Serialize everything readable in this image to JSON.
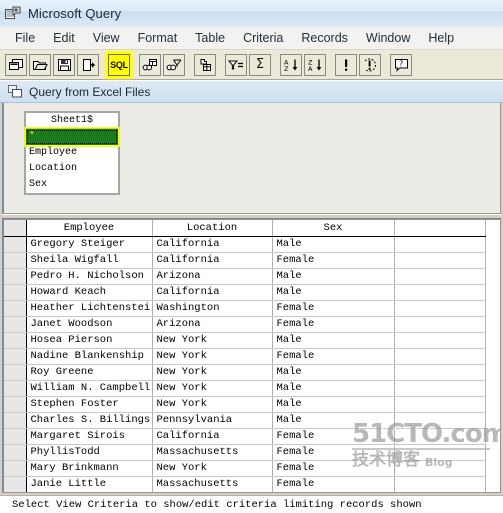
{
  "window": {
    "title": "Microsoft Query",
    "icon": "query-app-icon"
  },
  "menu": {
    "items": [
      {
        "label": "File"
      },
      {
        "label": "Edit"
      },
      {
        "label": "View"
      },
      {
        "label": "Format"
      },
      {
        "label": "Table"
      },
      {
        "label": "Criteria"
      },
      {
        "label": "Records"
      },
      {
        "label": "Window"
      },
      {
        "label": "Help"
      }
    ]
  },
  "toolbar": {
    "highlight_color": "#ffff00",
    "buttons": [
      {
        "name": "new-query-button",
        "icon": "new-query-icon",
        "label": ""
      },
      {
        "name": "open-query-button",
        "icon": "open-folder-icon",
        "label": ""
      },
      {
        "name": "save-query-button",
        "icon": "floppy-disk-icon",
        "label": ""
      },
      {
        "name": "return-data-button",
        "icon": "return-data-icon",
        "label": ""
      },
      {
        "name": "view-sql-button",
        "icon": "sql-icon",
        "label": "SQL",
        "highlighted": true
      },
      {
        "name": "show-tables-button",
        "icon": "show-tables-icon",
        "label": ""
      },
      {
        "name": "add-table-button",
        "icon": "join-tables-icon",
        "label": ""
      },
      {
        "name": "add-column-button",
        "icon": "add-column-icon",
        "label": ""
      },
      {
        "name": "criteria-button",
        "icon": "filter-equals-icon",
        "label": ""
      },
      {
        "name": "cycle-totals-button",
        "icon": "sigma-icon",
        "label": "Σ"
      },
      {
        "name": "sort-ascending-button",
        "icon": "sort-az-icon",
        "label": ""
      },
      {
        "name": "sort-descending-button",
        "icon": "sort-za-icon",
        "label": ""
      },
      {
        "name": "query-now-button",
        "icon": "exclamation-icon",
        "label": ""
      },
      {
        "name": "auto-query-button",
        "icon": "auto-query-icon",
        "label": ""
      },
      {
        "name": "help-button",
        "icon": "question-help-icon",
        "label": ""
      }
    ]
  },
  "query_window": {
    "title": "Query from Excel Files",
    "icon": "mdi-restore-icon"
  },
  "table_pane": {
    "table": {
      "caption": "Sheet1$",
      "fields": [
        {
          "label": "*",
          "selected": true
        },
        {
          "label": "Employee",
          "selected": false
        },
        {
          "label": "Location",
          "selected": false
        },
        {
          "label": "Sex",
          "selected": false
        }
      ]
    }
  },
  "grid": {
    "columns": [
      "Employee",
      "Location",
      "Sex",
      ""
    ],
    "rows": [
      [
        "Gregory Steiger",
        "California",
        "Male",
        ""
      ],
      [
        "Sheila Wigfall",
        "California",
        "Female",
        ""
      ],
      [
        "Pedro H. Nicholson",
        "Arizona",
        "Male",
        ""
      ],
      [
        "Howard Keach",
        "California",
        "Male",
        ""
      ],
      [
        "Heather Lichtenstei",
        "Washington",
        "Female",
        ""
      ],
      [
        "Janet Woodson",
        "Arizona",
        "Female",
        ""
      ],
      [
        "Hosea Pierson",
        "New York",
        "Male",
        ""
      ],
      [
        "Nadine Blankenship",
        "New York",
        "Female",
        ""
      ],
      [
        "Roy Greene",
        "New York",
        "Male",
        ""
      ],
      [
        "William N. Campbell",
        "New York",
        "Male",
        ""
      ],
      [
        "Stephen Foster",
        "New York",
        "Male",
        ""
      ],
      [
        "Charles S. Billings",
        "Pennsylvania",
        "Male",
        ""
      ],
      [
        "Margaret Sirois",
        "California",
        "Female",
        ""
      ],
      [
        "PhyllisTodd",
        "Massachusetts",
        "Female",
        ""
      ],
      [
        "Mary Brinkmann",
        "New York",
        "Female",
        ""
      ],
      [
        "Janie Little",
        "Massachusetts",
        "Female",
        ""
      ]
    ]
  },
  "watermark": {
    "top": "51CTO.com",
    "bottom_cn": "技术博客",
    "bottom_en": "Blog"
  },
  "status": {
    "text": "Select View Criteria to show/edit criteria limiting records shown"
  }
}
